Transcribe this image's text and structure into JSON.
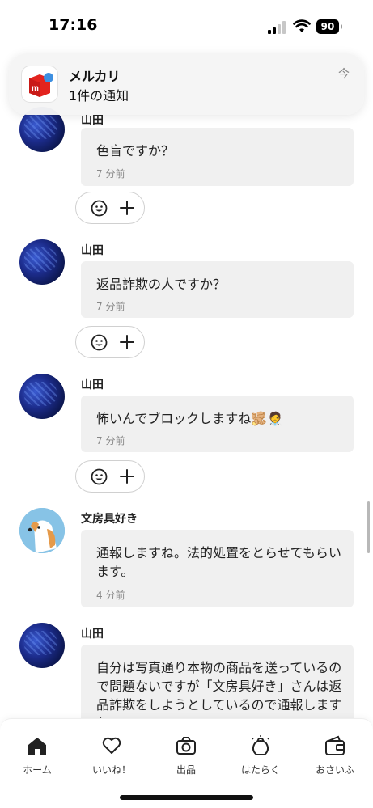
{
  "status_bar": {
    "time": "17:16",
    "battery": "90"
  },
  "notification": {
    "app_name": "メルカリ",
    "body": "1件の通知",
    "time": "今"
  },
  "messages": [
    {
      "sender": "山田",
      "text": "色盲ですか？",
      "time": "7 分前"
    },
    {
      "sender": "山田",
      "text": "返品詐欺の人ですか？",
      "time": "7 分前"
    },
    {
      "sender": "山田",
      "text": "怖いんでブロックしますね🫚🧑‍⚕️",
      "time": "7 分前"
    },
    {
      "sender": "文房具好き",
      "text": "通報しますね。法的処置をとらせてもらいます。",
      "time": "4 分前"
    },
    {
      "sender": "山田",
      "text": "自分は写真通り本物の商品を送っているので問題ないですが「文房具好き」さんは返品詐欺をしようとしているので通報しますね",
      "time": ""
    }
  ],
  "tabs": [
    {
      "label": "ホーム",
      "icon": "home-icon"
    },
    {
      "label": "いいね！",
      "icon": "heart-icon"
    },
    {
      "label": "出品",
      "icon": "camera-icon"
    },
    {
      "label": "はたらく",
      "icon": "work-bag-icon"
    },
    {
      "label": "おさいふ",
      "icon": "wallet-icon"
    }
  ],
  "colors": {
    "brand_red": "#e3231e",
    "bubble_bg": "#f0f0f0",
    "accent_blue": "#3d8fe0"
  }
}
